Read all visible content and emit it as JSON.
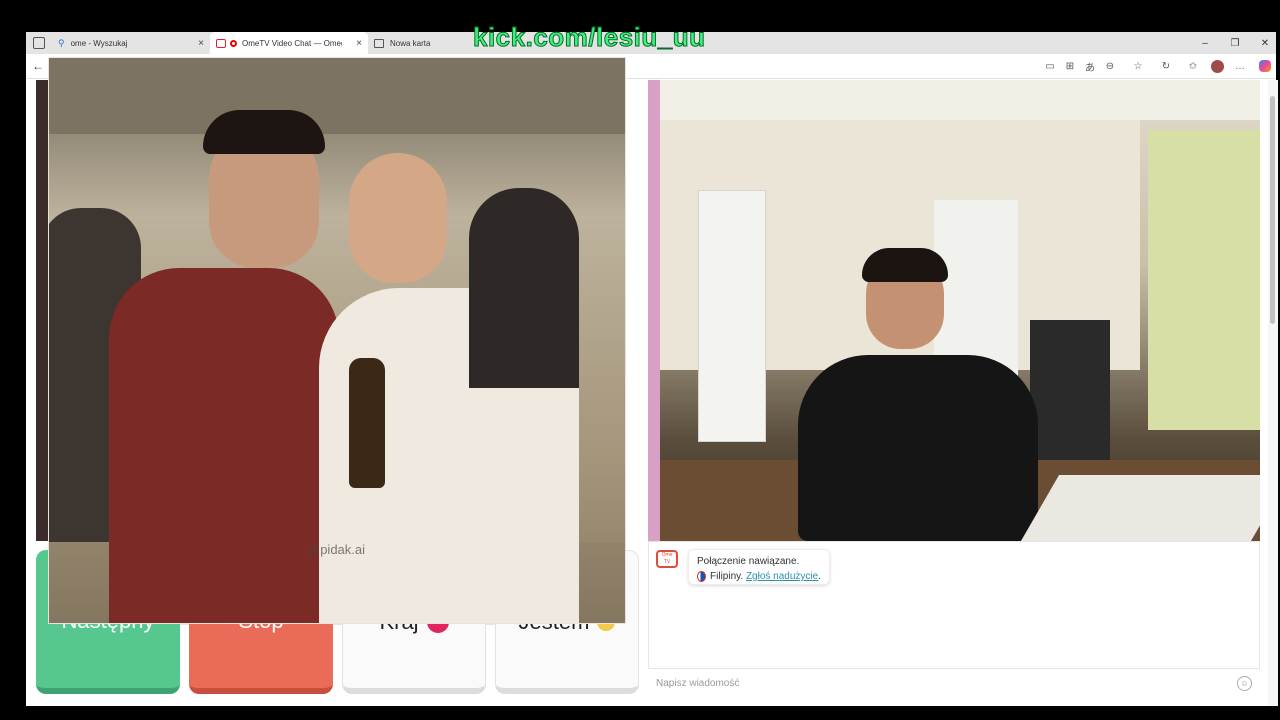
{
  "stream_watermark": "kick.com/lesiu_uu",
  "tabs": [
    {
      "label": "ome - Wyszukaj",
      "active": false
    },
    {
      "label": "OmeTV Video Chat — Omeg",
      "active": true
    },
    {
      "label": "Nowa karta",
      "active": false
    }
  ],
  "buttons": {
    "next": "Następny",
    "stop": "Stop",
    "country": "Kraj",
    "i_am": "Jestem"
  },
  "photo_watermark": "@pidak.ai",
  "chat": {
    "logo_line1": "Ome",
    "logo_line2": "TV",
    "connection_text": "Połączenie nawiązane.",
    "country_text": "Filipiny.",
    "report_link": "Zgłoś nadużycie",
    "report_suffix": ".",
    "input_placeholder": "Napisz wiadomość"
  },
  "colors": {
    "next_button": "#56c88f",
    "stop_button": "#e96b58",
    "watermark_green": "#3df27c",
    "link": "#2e8fae"
  },
  "icons": [
    "search-icon",
    "record-icon",
    "page-icon",
    "back-icon",
    "camera-icon",
    "read-aloud-icon",
    "translate-icon",
    "extensions-icon",
    "favorite-icon",
    "refresh-icon",
    "collections-icon",
    "profile-icon",
    "menu-icon",
    "copilot-icon",
    "emoji-icon",
    "flag-icon"
  ]
}
